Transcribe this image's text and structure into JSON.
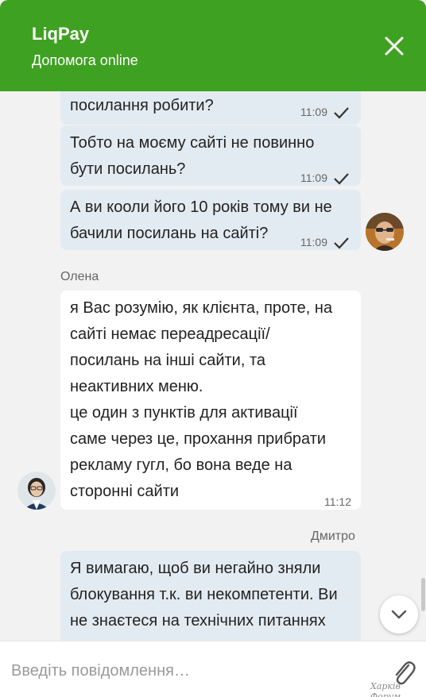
{
  "header": {
    "title": "LiqPay",
    "subtitle": "Допомога online",
    "accent_color": "#3fa122",
    "close_icon": "close-icon"
  },
  "messages": [
    {
      "direction": "outgoing",
      "lines": [
        "посилання робити?"
      ],
      "time": "11:09",
      "status": "read-check"
    },
    {
      "direction": "outgoing",
      "lines": [
        "Тобто на моєму сайті не повинно",
        "бути посилань?"
      ],
      "time": "11:09",
      "status": "read-check"
    },
    {
      "direction": "outgoing",
      "lines": [
        "А ви кооли його 10 років тому ви не",
        "бачили посилань на сайті?"
      ],
      "time": "11:09",
      "status": "read-check"
    },
    {
      "direction": "incoming",
      "sender": "Олена",
      "lines": [
        "я Вас розумію, як клієнта, проте, на",
        "сайті немає переадресації/",
        "посилань на інші сайти, та",
        "неактивних меню.",
        "це один з пунктів для активації",
        "саме через це, прохання прибрати",
        "рекламу гугл, бо вона веде на",
        "сторонні сайти"
      ],
      "time": "11:12"
    },
    {
      "direction": "outgoing",
      "sender": "Дмитро",
      "lines": [
        "Я вимагаю, щоб ви негайно зняли",
        "блокування т.к. ви некомпетенти. Ви",
        "не знаєтеся на технічних питаннях"
      ]
    }
  ],
  "composer": {
    "placeholder": "Введіть повідомлення…",
    "attach_icon": "paperclip-icon"
  },
  "scroll_button_icon": "chevron-down-icon",
  "watermark": "Харків Форум"
}
